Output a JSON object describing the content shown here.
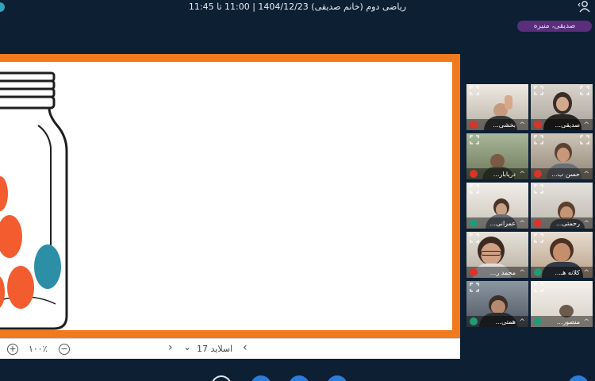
{
  "window": {
    "title": "ریاضی دوم (خانم صدیقی) 1404/12/23 | 11:00 تا 11:45"
  },
  "speaker": {
    "label": "صدیقی، منیره"
  },
  "presentation": {
    "slide_label": "اسلاید 17",
    "zoom": "۱۰۰٪",
    "zoom_in_label": "+",
    "zoom_out_label": "−",
    "prev_symbol": "‹",
    "next_symbol": "›",
    "dropdown_symbol": "⌄"
  },
  "participants": [
    {
      "name": "صدیقی...",
      "mic": "muted"
    },
    {
      "name": "بخشی...",
      "mic": "muted"
    },
    {
      "name": "حسن ب...",
      "mic": "muted"
    },
    {
      "name": "دریابار...",
      "mic": "muted"
    },
    {
      "name": "رحمتی...",
      "mic": "muted"
    },
    {
      "name": "عمرانی...",
      "mic": "on"
    },
    {
      "name": "کلانه هـ...",
      "mic": "on"
    },
    {
      "name": "محمد ر...",
      "mic": "muted"
    },
    {
      "name": "منصور...",
      "mic": "on"
    },
    {
      "name": "همتی...",
      "mic": "on"
    }
  ],
  "colors": {
    "background": "#0d1f33",
    "slide_border": "#f07a1d",
    "ball_orange": "#f25c2f",
    "ball_teal": "#2d8fa6",
    "mic_muted": "#d9342b",
    "mic_on": "#1e9c78"
  }
}
